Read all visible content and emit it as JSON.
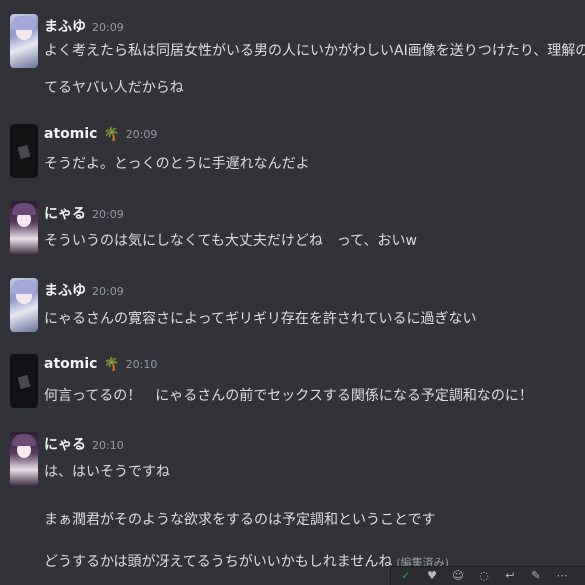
{
  "messages": [
    {
      "user": "まふゆ",
      "badge": "",
      "time": "20:09",
      "lines": [
        "よく考えたら私は同居女性がいる男の人にいかがわしいAI画像を送りつけたり、理解のある彼君ムーブを要求し",
        "てるヤバい人だからね"
      ]
    },
    {
      "user": "atomic",
      "badge": "🌴",
      "time": "20:09",
      "lines": [
        "そうだよ。とっくのとうに手遅れなんだよ"
      ]
    },
    {
      "user": "にゃる",
      "badge": "",
      "time": "20:09",
      "lines": [
        "そういうのは気にしなくても大丈夫だけどね　って、おいw"
      ]
    },
    {
      "user": "まふゆ",
      "badge": "",
      "time": "20:09",
      "lines": [
        "にゃるさんの寛容さによってギリギリ存在を許されているに過ぎない"
      ]
    },
    {
      "user": "atomic",
      "badge": "🌴",
      "time": "20:10",
      "lines": [
        "何言ってるの！　にゃるさんの前でセックスする関係になる予定調和なのに！"
      ]
    },
    {
      "user": "にゃる",
      "badge": "",
      "time": "20:10",
      "lines": [
        "は、はいそうですね",
        "まぁ潤君がそのような欲求をするのは予定調和ということです",
        "どうするかは頭が冴えてるうちがいいかもしれませんね"
      ],
      "edited": "(編集済み)"
    }
  ],
  "toolbar": {
    "icons": [
      "check-icon",
      "heart-icon",
      "reaction-icon",
      "more-reactions-icon",
      "reply-icon",
      "edit-icon",
      "more-icon"
    ],
    "glyphs": [
      "✓",
      "♥",
      "☺",
      "◌",
      "↩",
      "✎",
      "⋯"
    ],
    "colors": {
      "check": "#23a55a",
      "default": "#b5bac1"
    }
  }
}
